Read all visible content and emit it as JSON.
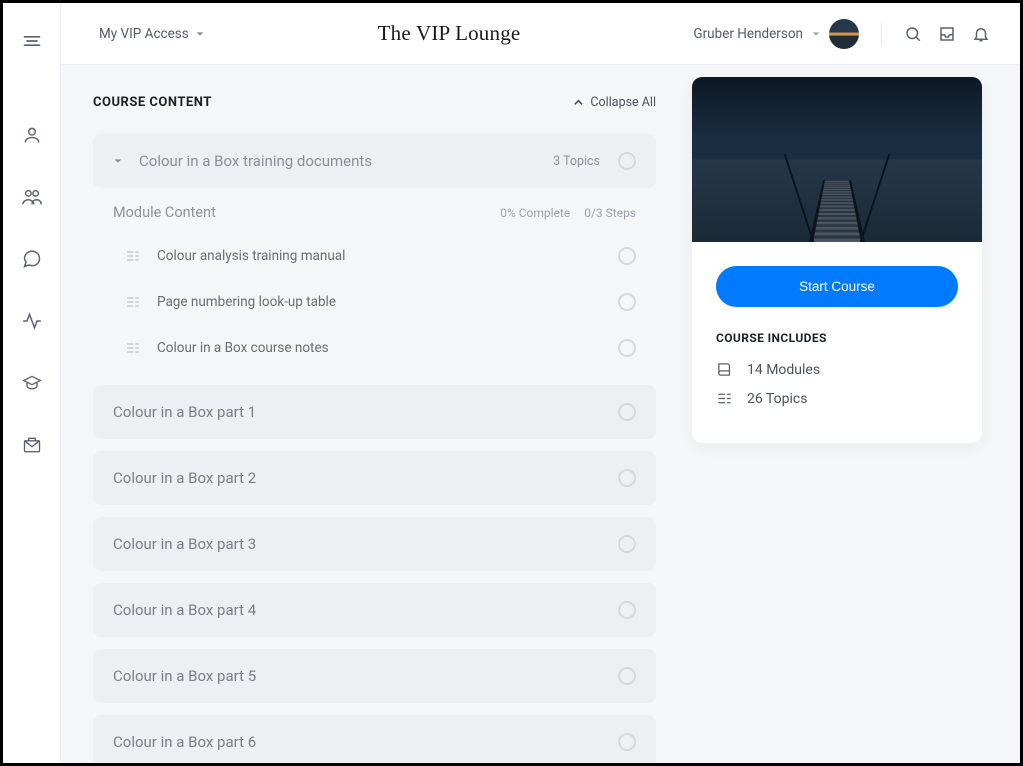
{
  "header": {
    "access_menu_label": "My VIP Access",
    "site_title": "The VIP Lounge",
    "user_name": "Gruber Henderson"
  },
  "course_content": {
    "heading": "COURSE CONTENT",
    "collapse_label": "Collapse All",
    "expanded_module": {
      "title": "Colour in a Box training documents",
      "topic_count_label": "3 Topics",
      "content_label": "Module Content",
      "progress_label": "0% Complete",
      "steps_label": "0/3 Steps",
      "topics": [
        "Colour analysis training manual",
        "Page numbering look-up table",
        "Colour in a Box course notes"
      ]
    },
    "collapsed_modules": [
      "Colour in a Box part 1",
      "Colour in a Box part 2",
      "Colour in a Box part 3",
      "Colour in a Box part 4",
      "Colour in a Box part 5",
      "Colour in a Box part 6"
    ]
  },
  "side_card": {
    "start_button": "Start Course",
    "includes_heading": "COURSE INCLUDES",
    "modules_label": "14 Modules",
    "topics_label": "26 Topics"
  }
}
